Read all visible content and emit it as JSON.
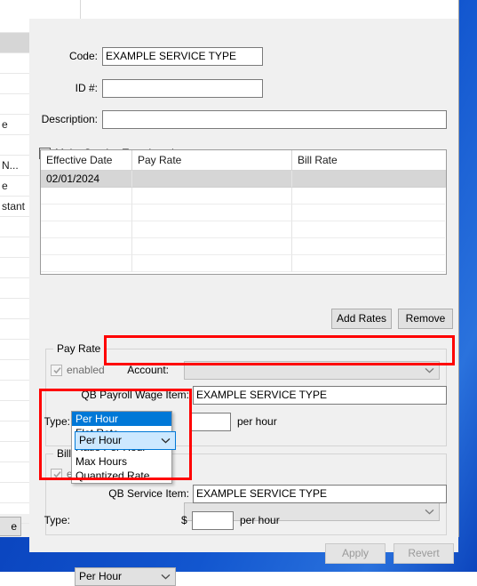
{
  "desktop": {
    "background_color": "#0b46c0"
  },
  "background_window": {
    "rows": [
      "",
      "",
      "",
      "",
      "",
      "e",
      "",
      "N...",
      "e",
      "stant",
      "",
      "",
      "",
      "",
      "",
      "",
      "",
      "",
      "",
      "",
      "",
      "",
      "",
      "",
      ""
    ],
    "selected_row_index": 1,
    "bottom_button_label": "e"
  },
  "dialog": {
    "fields": {
      "code_label": "Code:",
      "code_value": "EXAMPLE SERVICE TYPE",
      "id_label": "ID #:",
      "id_value": "",
      "description_label": "Description:",
      "description_value": ""
    },
    "inactive_checkbox": {
      "label": "Make Service Type Inactive",
      "checked": false
    },
    "rates_grid": {
      "columns": [
        "Effective Date",
        "Pay Rate",
        "Bill Rate"
      ],
      "rows": [
        {
          "effective_date": "02/01/2024",
          "pay_rate": "",
          "bill_rate": "",
          "selected": true
        }
      ],
      "empty_row_count": 5
    },
    "grid_buttons": {
      "add_rates": "Add Rates",
      "remove": "Remove"
    },
    "pay_rate_group": {
      "title": "Pay Rate",
      "enabled_label": "enabled",
      "enabled_checked": true,
      "enabled_disabled": true,
      "account_label": "Account:",
      "account_value": "",
      "qb_item_label": "QB Payroll Wage Item:",
      "qb_item_value": "EXAMPLE SERVICE TYPE",
      "type_label": "Type:",
      "type_value": "Per Hour",
      "amount_value": "",
      "amount_suffix": "per hour"
    },
    "bill_rate_group": {
      "title": "Bill Rate",
      "enabled_label": "enabled",
      "enabled_checked": true,
      "enabled_disabled": true,
      "account_value": "",
      "qb_item_label": "QB Service Item:",
      "qb_item_value": "EXAMPLE SERVICE TYPE",
      "type_label": "Type:",
      "type_value": "Per Hour",
      "currency_symbol": "$",
      "amount_value": "",
      "amount_suffix": "per hour"
    },
    "footer_buttons": {
      "apply": "Apply",
      "apply_disabled": true,
      "revert": "Revert",
      "revert_disabled": true
    }
  },
  "dropdown": {
    "open": true,
    "options": [
      "Per Hour",
      "Flat Rate",
      "Ratio Per Hour",
      "Max Hours",
      "Quantized Rate"
    ],
    "selected_index": 0,
    "highlight_color": "#0078d7"
  },
  "annotations": {
    "highlight_color": "#ff0000",
    "boxes": [
      "account-row-highlight",
      "type-dropdown-highlight"
    ]
  }
}
